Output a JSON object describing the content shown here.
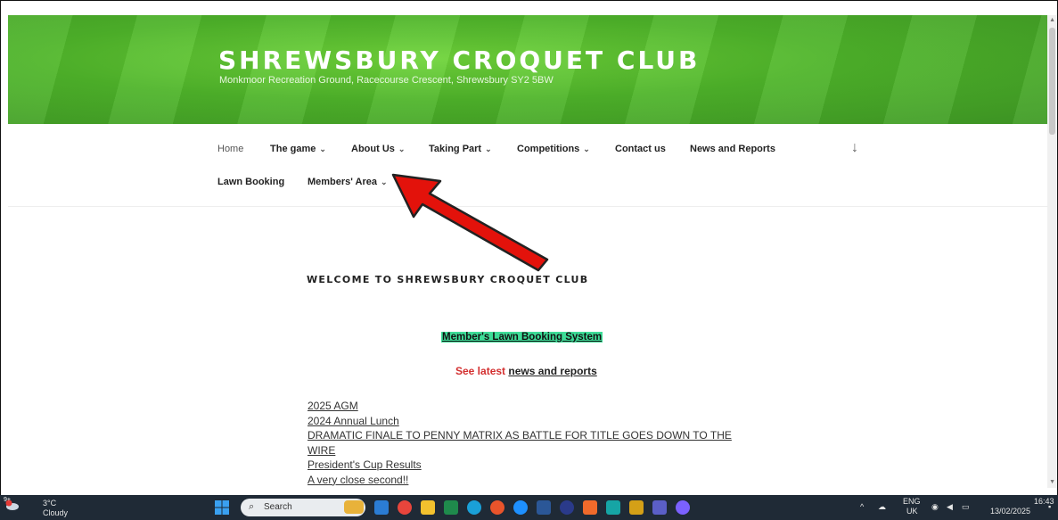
{
  "header": {
    "site_title": "SHREWSBURY CROQUET CLUB",
    "subtitle": "Monkmoor Recreation Ground, Racecourse Crescent, Shrewsbury SY2 5BW"
  },
  "nav": {
    "items": [
      {
        "label": "Home",
        "has_dropdown": false
      },
      {
        "label": "The game",
        "has_dropdown": true
      },
      {
        "label": "About Us",
        "has_dropdown": true
      },
      {
        "label": "Taking Part",
        "has_dropdown": true
      },
      {
        "label": "Competitions",
        "has_dropdown": true
      },
      {
        "label": "Contact us",
        "has_dropdown": false
      },
      {
        "label": "News and Reports",
        "has_dropdown": false
      },
      {
        "label": "Lawn Booking",
        "has_dropdown": false
      },
      {
        "label": "Members' Area",
        "has_dropdown": true
      }
    ],
    "caret_glyph": "⌄",
    "scroll_down_glyph": "↓"
  },
  "annotation": {
    "arrow_color": "#e3120b",
    "arrow_outline": "#222222",
    "points_to": "Members' Area"
  },
  "content": {
    "welcome_heading": "WELCOME TO SHREWSBURY CROQUET CLUB",
    "lawn_booking_link": "Member's Lawn Booking System",
    "lawn_highlight_color": "#3ddc97",
    "latest_prefix": "See latest",
    "latest_link": "news and reports",
    "links": [
      "2025 AGM",
      "2024 Annual Lunch",
      "DRAMATIC FINALE TO PENNY MATRIX AS  BATTLE FOR TITLE GOES DOWN TO THE",
      "WIRE",
      "President's Cup Results",
      "A very close second!!"
    ]
  },
  "taskbar": {
    "weather_temp": "3°C",
    "weather_desc": "Cloudy",
    "weather_badge": "9+",
    "search_placeholder": "Search",
    "lang_top": "ENG",
    "lang_bottom": "UK",
    "time": "16:43",
    "date": "13/02/2025"
  }
}
